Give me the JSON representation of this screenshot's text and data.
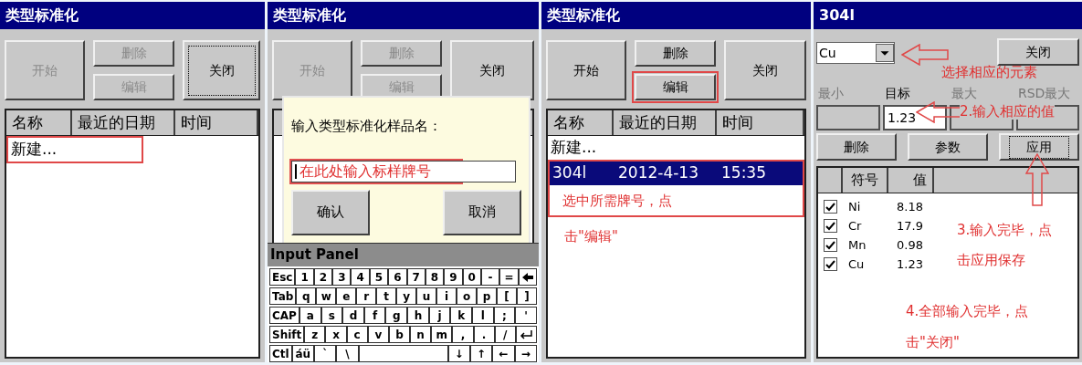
{
  "panels": [
    {
      "kind": "list",
      "title": "类型标准化",
      "buttons": [
        {
          "label": "开始",
          "disabled": true,
          "focused": false
        },
        {
          "label": "删除",
          "disabled": true,
          "focused": false
        },
        {
          "label": "编辑",
          "disabled": true,
          "focused": false
        },
        {
          "label": "关闭",
          "disabled": false,
          "focused": true
        }
      ],
      "columns": [
        "名称",
        "最近的日期",
        "时间"
      ],
      "rows": [
        {
          "cells": [
            "新建..."
          ],
          "selected": false,
          "highlighted": true
        }
      ]
    },
    {
      "kind": "dialog",
      "title": "类型标准化",
      "buttons": [
        {
          "label": "开始",
          "disabled": true,
          "focused": false
        },
        {
          "label": "删除",
          "disabled": true,
          "focused": false
        },
        {
          "label": "编辑",
          "disabled": true,
          "focused": false
        },
        {
          "label": "关闭",
          "disabled": false,
          "focused": false
        }
      ],
      "dialog": {
        "prompt": "输入类型标准化样品名：",
        "placeholder": "在此处输入标样牌号",
        "buttons": [
          "确认",
          "取消"
        ]
      },
      "keyboard": {
        "title": "Input Panel",
        "rows": [
          {
            "keys": [
              {
                "label": "Esc"
              },
              {
                "label": "1"
              },
              {
                "label": "2"
              },
              {
                "label": "3"
              },
              {
                "label": "4"
              },
              {
                "label": "5"
              },
              {
                "label": "6"
              },
              {
                "label": "7"
              },
              {
                "label": "8"
              },
              {
                "label": "9"
              },
              {
                "label": "0"
              },
              {
                "label": "-"
              },
              {
                "label": "="
              },
              {
                "kind": "backspace"
              }
            ]
          },
          {
            "keys": [
              {
                "label": "Tab"
              },
              {
                "label": "q"
              },
              {
                "label": "w"
              },
              {
                "label": "e"
              },
              {
                "label": "r"
              },
              {
                "label": "t"
              },
              {
                "label": "y"
              },
              {
                "label": "u"
              },
              {
                "label": "i"
              },
              {
                "label": "o"
              },
              {
                "label": "p"
              },
              {
                "label": "["
              },
              {
                "label": "]"
              }
            ]
          },
          {
            "keys": [
              {
                "label": "CAP"
              },
              {
                "label": "a"
              },
              {
                "label": "s"
              },
              {
                "label": "d"
              },
              {
                "label": "f"
              },
              {
                "label": "g"
              },
              {
                "label": "h"
              },
              {
                "label": "j"
              },
              {
                "label": "k"
              },
              {
                "label": "l"
              },
              {
                "label": ";"
              },
              {
                "label": "'"
              }
            ]
          },
          {
            "keys": [
              {
                "label": "Shift"
              },
              {
                "label": "z"
              },
              {
                "label": "x"
              },
              {
                "label": "c"
              },
              {
                "label": "v"
              },
              {
                "label": "b"
              },
              {
                "label": "n"
              },
              {
                "label": "m"
              },
              {
                "label": ","
              },
              {
                "label": "."
              },
              {
                "label": "/"
              },
              {
                "kind": "enter"
              }
            ]
          },
          {
            "keys": [
              {
                "label": "Ctl"
              },
              {
                "label": "áü"
              },
              {
                "label": "`"
              },
              {
                "label": "\\"
              },
              {
                "kind": "space"
              },
              {
                "label": "↓"
              },
              {
                "label": "↑"
              },
              {
                "label": "←"
              },
              {
                "label": "→"
              }
            ]
          }
        ]
      }
    },
    {
      "kind": "list",
      "title": "类型标准化",
      "buttons": [
        {
          "label": "开始",
          "disabled": false,
          "focused": false
        },
        {
          "label": "删除",
          "disabled": false,
          "focused": false
        },
        {
          "label": "编辑",
          "disabled": false,
          "focused": false,
          "highlighted": true
        },
        {
          "label": "关闭",
          "disabled": false,
          "focused": false
        }
      ],
      "columns": [
        "名称",
        "最近的日期",
        "时间"
      ],
      "rows": [
        {
          "cells": [
            "新建..."
          ],
          "selected": false,
          "highlighted": false
        },
        {
          "cells": [
            "304l",
            "2012-4-13",
            "15:35"
          ],
          "selected": true,
          "highlighted": true
        }
      ],
      "notes": [
        "选中所需牌号，点",
        "击\"编辑\""
      ]
    },
    {
      "kind": "editor",
      "title": "304l",
      "element": "Cu",
      "close": "关闭",
      "labels": [
        {
          "text": "最小",
          "disabled": true
        },
        {
          "text": "目标",
          "disabled": false
        },
        {
          "text": "最大",
          "disabled": true
        },
        {
          "text": "RSD最大",
          "disabled": true
        }
      ],
      "fields": [
        {
          "editable": false
        },
        {
          "editable": true,
          "value": "1.23"
        },
        {
          "editable": false
        },
        {
          "editable": false
        }
      ],
      "buttons": [
        {
          "label": "删除",
          "focused": false
        },
        {
          "label": "参数",
          "focused": false
        },
        {
          "label": "应用",
          "focused": true
        }
      ],
      "columns": [
        "符号",
        "值"
      ],
      "rows": [
        {
          "checked": true,
          "symbol": "Ni",
          "value": "8.18"
        },
        {
          "checked": true,
          "symbol": "Cr",
          "value": "17.9"
        },
        {
          "checked": true,
          "symbol": "Mn",
          "value": "0.98"
        },
        {
          "checked": true,
          "symbol": "Cu",
          "value": "1.23"
        }
      ],
      "element_note": "选择相应的元素",
      "value_note": "2.输入相应的值",
      "apply_note": [
        "3.输入完毕，点",
        "击应用保存"
      ],
      "close_note": [
        "4.全部输入完毕，点",
        "击\"关闭\""
      ]
    }
  ]
}
